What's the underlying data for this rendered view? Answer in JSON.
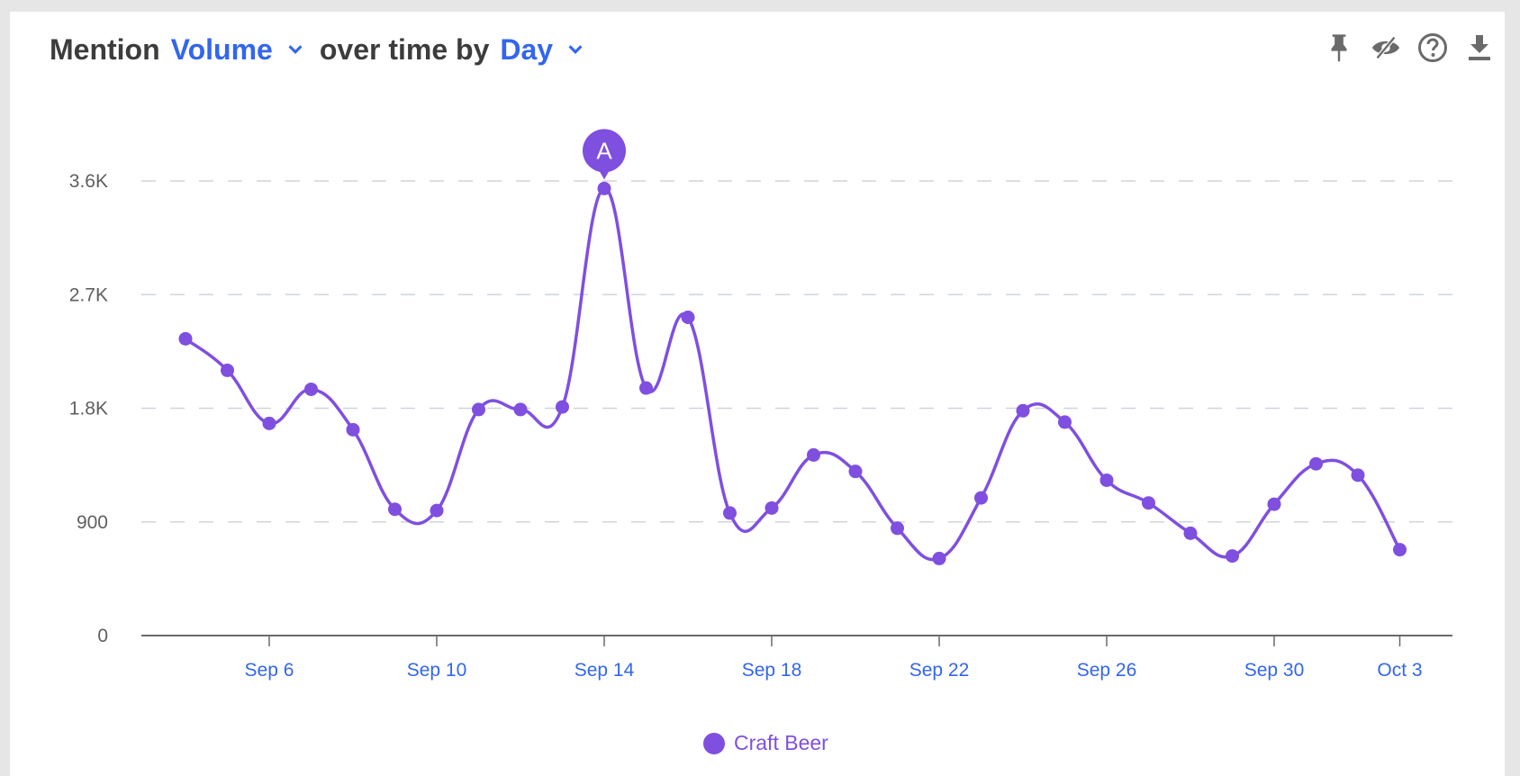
{
  "header": {
    "prefix": "Mention",
    "metric": "Volume",
    "middle": "over time by",
    "interval": "Day"
  },
  "toolbar": {
    "icons": [
      "pin-icon",
      "hide-icon",
      "help-icon",
      "download-icon"
    ]
  },
  "colors": {
    "series": "#7f4fe0",
    "accent": "#3366ee",
    "grid": "#d0d4dc",
    "axis": "#6a6a6a"
  },
  "chart_data": {
    "type": "line",
    "title": "Mention Volume over time by Day",
    "xlabel": "",
    "ylabel": "",
    "ylim": [
      0,
      3600
    ],
    "yticks": [
      0,
      900,
      1800,
      2700,
      3600
    ],
    "ytick_labels": [
      "0",
      "900",
      "1.8K",
      "2.7K",
      "3.6K"
    ],
    "grid": true,
    "xtick_labels": [
      "Sep 6",
      "Sep 10",
      "Sep 14",
      "Sep 18",
      "Sep 22",
      "Sep 26",
      "Sep 30",
      "Oct 3"
    ],
    "xtick_index": [
      2,
      6,
      10,
      14,
      18,
      22,
      26,
      29
    ],
    "x": [
      "Sep 4",
      "Sep 5",
      "Sep 6",
      "Sep 7",
      "Sep 8",
      "Sep 9",
      "Sep 10",
      "Sep 11",
      "Sep 12",
      "Sep 13",
      "Sep 14",
      "Sep 15",
      "Sep 16",
      "Sep 17",
      "Sep 18",
      "Sep 19",
      "Sep 20",
      "Sep 21",
      "Sep 22",
      "Sep 23",
      "Sep 24",
      "Sep 25",
      "Sep 26",
      "Sep 27",
      "Sep 28",
      "Sep 29",
      "Sep 30",
      "Oct 1",
      "Oct 2",
      "Oct 3"
    ],
    "series": [
      {
        "name": "Craft Beer",
        "values": [
          2350,
          2100,
          1680,
          1950,
          1630,
          1000,
          990,
          1790,
          1790,
          1810,
          3540,
          1960,
          2520,
          970,
          1010,
          1430,
          1300,
          850,
          610,
          1090,
          1780,
          1690,
          1230,
          1050,
          810,
          630,
          1040,
          1360,
          1270,
          680
        ]
      }
    ],
    "annotations": [
      {
        "label": "A",
        "x": "Sep 14"
      }
    ],
    "legend": {
      "position": "bottom",
      "entries": [
        "Craft Beer"
      ]
    }
  }
}
